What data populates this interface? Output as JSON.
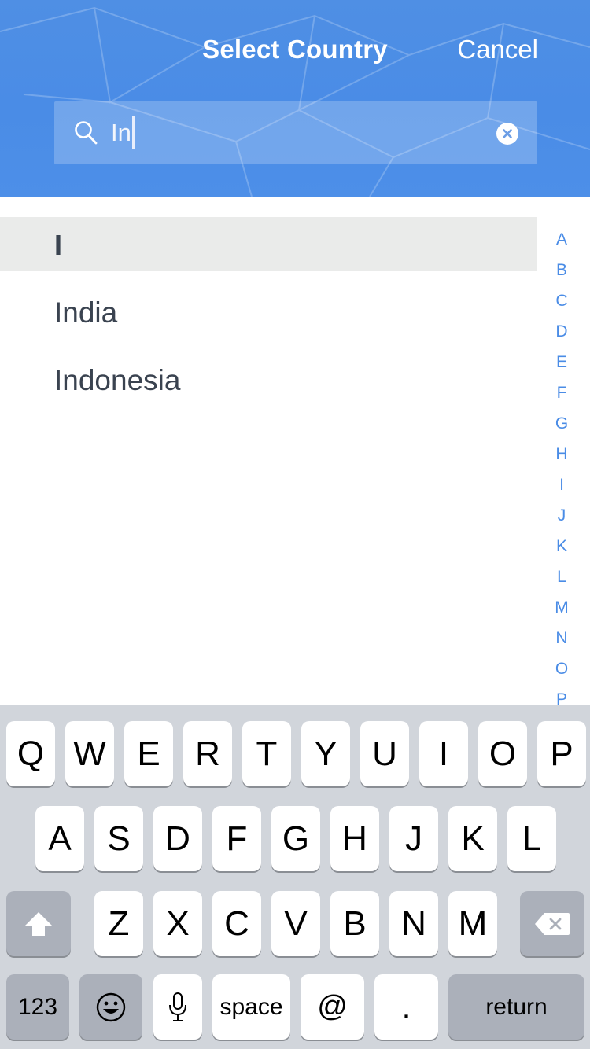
{
  "header": {
    "title": "Select Country",
    "cancel_label": "Cancel"
  },
  "search": {
    "value": "In"
  },
  "list": {
    "section": "I",
    "items": [
      "India",
      "Indonesia"
    ]
  },
  "index": [
    "A",
    "B",
    "C",
    "D",
    "E",
    "F",
    "G",
    "H",
    "I",
    "J",
    "K",
    "L",
    "M",
    "N",
    "O",
    "P"
  ],
  "keyboard": {
    "row1": [
      "Q",
      "W",
      "E",
      "R",
      "T",
      "Y",
      "U",
      "I",
      "O",
      "P"
    ],
    "row2": [
      "A",
      "S",
      "D",
      "F",
      "G",
      "H",
      "J",
      "K",
      "L"
    ],
    "row3": [
      "Z",
      "X",
      "C",
      "V",
      "B",
      "N",
      "M"
    ],
    "numbers_label": "123",
    "space_label": "space",
    "at_label": "@",
    "dot_label": ".",
    "return_label": "return"
  },
  "colors": {
    "accent": "#4a8ce6",
    "header": "#4d8fe8",
    "text": "#3a4350",
    "keyboard_bg": "#d1d5db",
    "key_dark": "#abb0ba"
  }
}
